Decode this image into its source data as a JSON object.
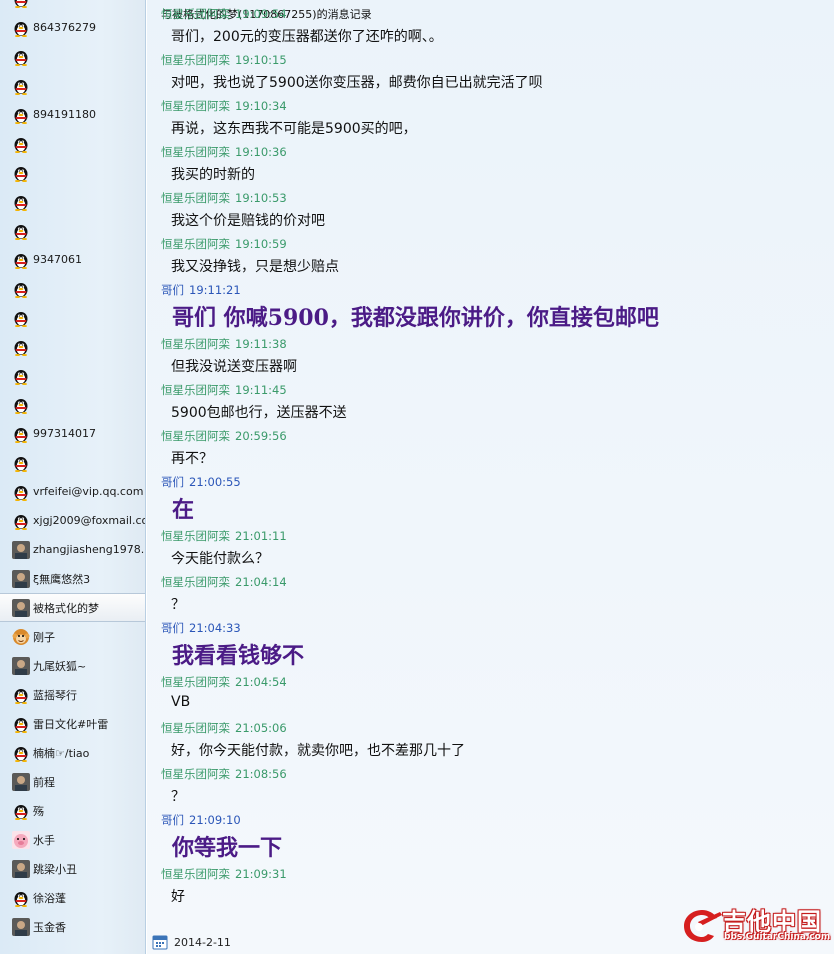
{
  "window": {
    "header": "与被格式化的梦(1170867255)的消息记录"
  },
  "sidebar": {
    "contacts": [
      {
        "name": "",
        "avatar": "qq-penguin-icon"
      },
      {
        "name": "864376279",
        "avatar": "qq-penguin-icon"
      },
      {
        "name": "",
        "avatar": "qq-penguin-icon"
      },
      {
        "name": "",
        "avatar": "qq-penguin-icon"
      },
      {
        "name": "894191180",
        "avatar": "qq-penguin-icon"
      },
      {
        "name": "",
        "avatar": "qq-penguin-icon"
      },
      {
        "name": "",
        "avatar": "qq-penguin-icon"
      },
      {
        "name": "",
        "avatar": "qq-penguin-icon"
      },
      {
        "name": "",
        "avatar": "qq-penguin-icon"
      },
      {
        "name": "9347061",
        "avatar": "qq-penguin-icon"
      },
      {
        "name": "",
        "avatar": "qq-penguin-icon"
      },
      {
        "name": "",
        "avatar": "qq-penguin-icon"
      },
      {
        "name": "",
        "avatar": "qq-penguin-icon"
      },
      {
        "name": "",
        "avatar": "qq-penguin-icon"
      },
      {
        "name": "",
        "avatar": "qq-penguin-icon"
      },
      {
        "name": "997314017",
        "avatar": "qq-penguin-icon"
      },
      {
        "name": "",
        "avatar": "qq-penguin-icon"
      },
      {
        "name": "vrfeifei@vip.qq.com",
        "avatar": "qq-penguin-icon"
      },
      {
        "name": "xjgj2009@foxmail.com",
        "avatar": "qq-penguin-icon"
      },
      {
        "name": "zhangjiasheng1978...",
        "avatar": "photo-avatar"
      },
      {
        "name": "ξ無鹰悠然3",
        "avatar": "photo-avatar"
      },
      {
        "name": "被格式化的梦",
        "avatar": "photo-avatar",
        "selected": true
      },
      {
        "name": "刚子",
        "avatar": "monkey-avatar"
      },
      {
        "name": "九尾妖狐~",
        "avatar": "photo-avatar"
      },
      {
        "name": "蓝摇琴行",
        "avatar": "qq-penguin-icon"
      },
      {
        "name": "雷日文化#叶雷",
        "avatar": "qq-penguin-icon"
      },
      {
        "name": "楠楠☞/tiao",
        "avatar": "qq-penguin-icon"
      },
      {
        "name": "前程",
        "avatar": "photo-avatar"
      },
      {
        "name": "殇",
        "avatar": "qq-penguin-icon"
      },
      {
        "name": "水手",
        "avatar": "pig-avatar"
      },
      {
        "name": "跳梁小丑",
        "avatar": "photo-avatar"
      },
      {
        "name": "徐浴蓬",
        "avatar": "qq-penguin-icon"
      },
      {
        "name": "玉金香",
        "avatar": "photo-avatar"
      }
    ]
  },
  "messages": [
    {
      "sender": "恒星乐团阿栾",
      "time": "19:09:54",
      "text": "哥们，200元的变压器都送你了还咋的啊、。",
      "self": false
    },
    {
      "sender": "恒星乐团阿栾",
      "time": "19:10:15",
      "text": "对吧，我也说了5900送你变压器，邮费你自已出就完活了呗",
      "self": false
    },
    {
      "sender": "恒星乐团阿栾",
      "time": "19:10:34",
      "text": "再说，这东西我不可能是5900买的吧，",
      "self": false
    },
    {
      "sender": "恒星乐团阿栾",
      "time": "19:10:36",
      "text": "我买的时新的",
      "self": false
    },
    {
      "sender": "恒星乐团阿栾",
      "time": "19:10:53",
      "text": "我这个价是赔钱的价对吧",
      "self": false
    },
    {
      "sender": "恒星乐团阿栾",
      "time": "19:10:59",
      "text": "我又没挣钱，只是想少赔点",
      "self": false
    },
    {
      "sender": "哥们",
      "time": "19:11:21",
      "text": "哥们 你喊5900，我都没跟你讲价，你直接包邮吧",
      "self": true
    },
    {
      "sender": "恒星乐团阿栾",
      "time": "19:11:38",
      "text": "但我没说送变压器啊",
      "self": false
    },
    {
      "sender": "恒星乐团阿栾",
      "time": "19:11:45",
      "text": "5900包邮也行，送压器不送",
      "self": false
    },
    {
      "sender": "恒星乐团阿栾",
      "time": "20:59:56",
      "text": "再不？",
      "self": false
    },
    {
      "sender": "哥们",
      "time": "21:00:55",
      "text": "在",
      "self": true
    },
    {
      "sender": "恒星乐团阿栾",
      "time": "21:01:11",
      "text": "今天能付款么？",
      "self": false
    },
    {
      "sender": "恒星乐团阿栾",
      "time": "21:04:14",
      "text": "？",
      "self": false
    },
    {
      "sender": "哥们",
      "time": "21:04:33",
      "text": "我看看钱够不",
      "self": true
    },
    {
      "sender": "恒星乐团阿栾",
      "time": "21:04:54",
      "text": "VB",
      "self": false
    },
    {
      "sender": "恒星乐团阿栾",
      "time": "21:05:06",
      "text": "好，你今天能付款，就卖你吧，也不差那几十了",
      "self": false
    },
    {
      "sender": "恒星乐团阿栾",
      "time": "21:08:56",
      "text": "？",
      "self": false
    },
    {
      "sender": "哥们",
      "time": "21:09:10",
      "text": "你等我一下",
      "self": true
    },
    {
      "sender": "恒星乐团阿栾",
      "time": "21:09:31",
      "text": "好",
      "self": false
    }
  ],
  "footer": {
    "date": "2014-2-11",
    "date_icon": "calendar-icon"
  },
  "watermark": {
    "title": "吉他中国",
    "url": "bbs.GuitarChina.com"
  },
  "colors": {
    "other_sender": "#3a9a6a",
    "self_sender": "#2b56b8",
    "self_text": "#4b1b86",
    "sidebar_bg": "#dbeaf6",
    "chat_bg": "#ebf3fa"
  }
}
